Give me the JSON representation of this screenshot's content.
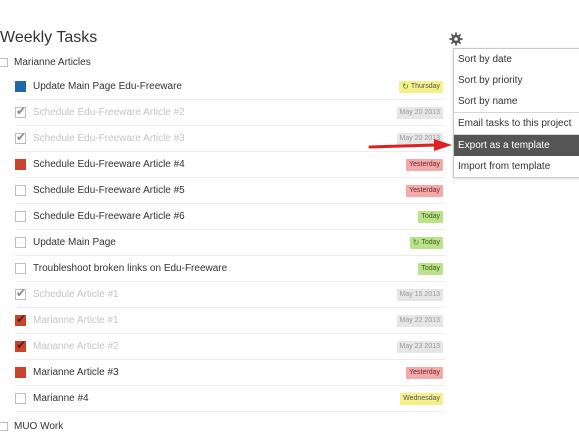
{
  "project": {
    "title": "Weekly Tasks",
    "sections": [
      "Marianne Articles",
      "MUO Work"
    ]
  },
  "tasks": [
    {
      "label": "Update Main Page Edu-Freeware",
      "state": "blue",
      "done": false,
      "badge": "Thursday",
      "badge_color": "yellow",
      "repeat": true
    },
    {
      "label": "Schedule Edu-Freeware Article #2",
      "state": "checked",
      "done": true,
      "badge": "May 20 2013",
      "badge_color": "grey",
      "repeat": false
    },
    {
      "label": "Schedule Edu-Freeware Article #3",
      "state": "checked",
      "done": true,
      "badge": "May 20 2013",
      "badge_color": "grey",
      "repeat": false
    },
    {
      "label": "Schedule Edu-Freeware Article #4",
      "state": "red",
      "done": false,
      "badge": "Yesterday",
      "badge_color": "pink",
      "repeat": false
    },
    {
      "label": "Schedule Edu-Freeware Article #5",
      "state": "empty",
      "done": false,
      "badge": "Yesterday",
      "badge_color": "pink",
      "repeat": false
    },
    {
      "label": "Schedule Edu-Freeware Article #6",
      "state": "empty",
      "done": false,
      "badge": "Today",
      "badge_color": "green",
      "repeat": false
    },
    {
      "label": "Update Main Page",
      "state": "empty",
      "done": false,
      "badge": "Today",
      "badge_color": "green",
      "repeat": true
    },
    {
      "label": "Troubleshoot broken links on Edu-Freeware",
      "state": "empty",
      "done": false,
      "badge": "Today",
      "badge_color": "green",
      "repeat": false
    },
    {
      "label": "Schedule Article #1",
      "state": "checked",
      "done": true,
      "badge": "May 15 2013",
      "badge_color": "grey",
      "repeat": false
    },
    {
      "label": "Marianne Article #1",
      "state": "redcheck",
      "done": true,
      "badge": "May 22 2013",
      "badge_color": "grey",
      "repeat": false
    },
    {
      "label": "Marianne Article #2",
      "state": "redcheck",
      "done": true,
      "badge": "May 23 2013",
      "badge_color": "grey",
      "repeat": false
    },
    {
      "label": "Marianne Article #3",
      "state": "red",
      "done": false,
      "badge": "Yesterday",
      "badge_color": "pink",
      "repeat": false
    },
    {
      "label": "Marianne #4",
      "state": "empty",
      "done": false,
      "badge": "Wednesday",
      "badge_color": "yellow",
      "repeat": false
    }
  ],
  "settings_icon": "gear-icon",
  "menu": {
    "items": [
      "Sort by date",
      "Sort by priority",
      "Sort by name",
      "Email tasks to this project",
      "Export as a template",
      "Import from template"
    ],
    "highlighted": "Export as a template"
  },
  "colors": {
    "priority_blue": "#1e6aa8",
    "priority_red": "#c8452b",
    "badge_yellow": "#f5f089",
    "badge_pink": "#f4a9aa",
    "badge_green": "#b9e28a",
    "badge_grey": "#e6e6e6",
    "menu_highlight": "#555555",
    "annotation_arrow": "#e02020"
  }
}
